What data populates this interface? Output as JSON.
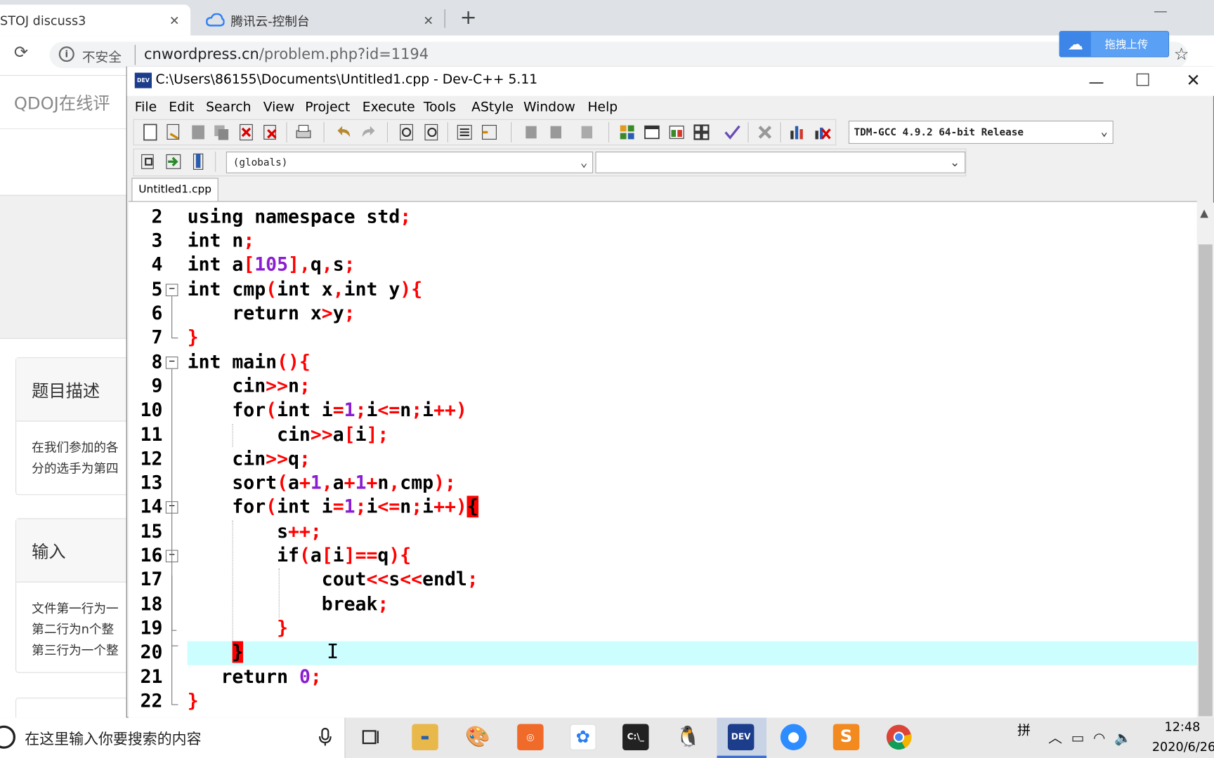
{
  "browser": {
    "tabs": [
      {
        "label": "STOJ discuss3",
        "close": "✕"
      },
      {
        "label": "腾讯云-控制台",
        "close": "✕"
      }
    ],
    "new_tab": "+",
    "security_label": "不安全",
    "url_host": "cnwordpress.cn",
    "url_path": "/problem.php?id=1194",
    "extension_label": "拖拽上传"
  },
  "webpage": {
    "site_title": "QDOJ在线评",
    "sections": [
      {
        "heading": "题目描述",
        "body": [
          "在我们参加的各",
          "分的选手为第四"
        ]
      },
      {
        "heading": "输入",
        "body": [
          "文件第一行为一",
          "第二行为n个整",
          "第三行为一个整"
        ]
      }
    ]
  },
  "devcpp": {
    "title": "C:\\Users\\86155\\Documents\\Untitled1.cpp - Dev-C++ 5.11",
    "menu": [
      "File",
      "Edit",
      "Search",
      "View",
      "Project",
      "Execute",
      "Tools",
      "AStyle",
      "Window",
      "Help"
    ],
    "compiler": "TDM-GCC 4.9.2 64-bit Release",
    "scope": "(globals)",
    "file_tab": "Untitled1.cpp",
    "line_numbers": [
      "2",
      "3",
      "4",
      "5",
      "6",
      "7",
      "8",
      "9",
      "10",
      "11",
      "12",
      "13",
      "14",
      "15",
      "16",
      "17",
      "18",
      "19",
      "20",
      "21",
      "22"
    ]
  },
  "taskbar": {
    "search_placeholder": "在这里输入你要搜索的内容",
    "ime": "拼",
    "time": "12:48",
    "date": "2020/6/26"
  }
}
